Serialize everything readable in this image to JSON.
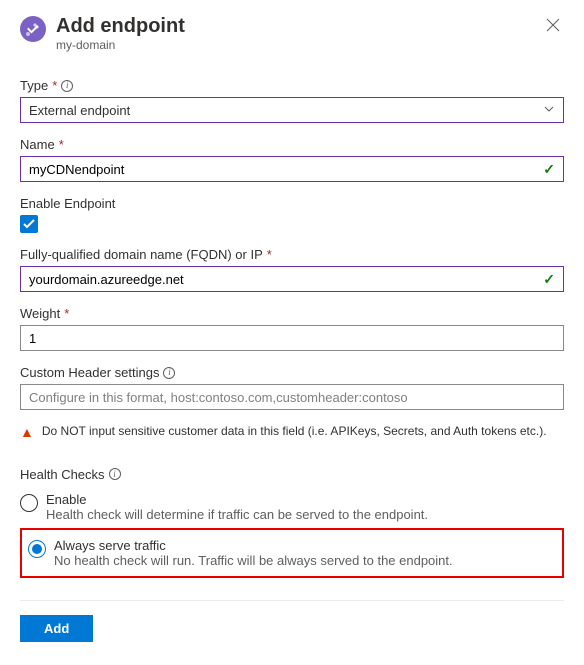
{
  "header": {
    "title": "Add endpoint",
    "subtitle": "my-domain"
  },
  "type": {
    "label": "Type",
    "value": "External endpoint"
  },
  "name": {
    "label": "Name",
    "value": "myCDNendpoint"
  },
  "enable": {
    "label": "Enable Endpoint",
    "checked": true
  },
  "fqdn": {
    "label": "Fully-qualified domain name (FQDN) or IP",
    "value": "yourdomain.azureedge.net"
  },
  "weight": {
    "label": "Weight",
    "value": "1"
  },
  "customHeader": {
    "label": "Custom Header settings",
    "placeholder": "Configure in this format, host:contoso.com,customheader:contoso"
  },
  "warning": "Do NOT input sensitive customer data in this field (i.e. APIKeys, Secrets, and Auth tokens etc.).",
  "healthChecks": {
    "label": "Health Checks",
    "options": [
      {
        "title": "Enable",
        "sub": "Health check will determine if traffic can be served to the endpoint.",
        "selected": false
      },
      {
        "title": "Always serve traffic",
        "sub": "No health check will run. Traffic will be always served to the endpoint.",
        "selected": true
      }
    ]
  },
  "footer": {
    "add": "Add"
  }
}
